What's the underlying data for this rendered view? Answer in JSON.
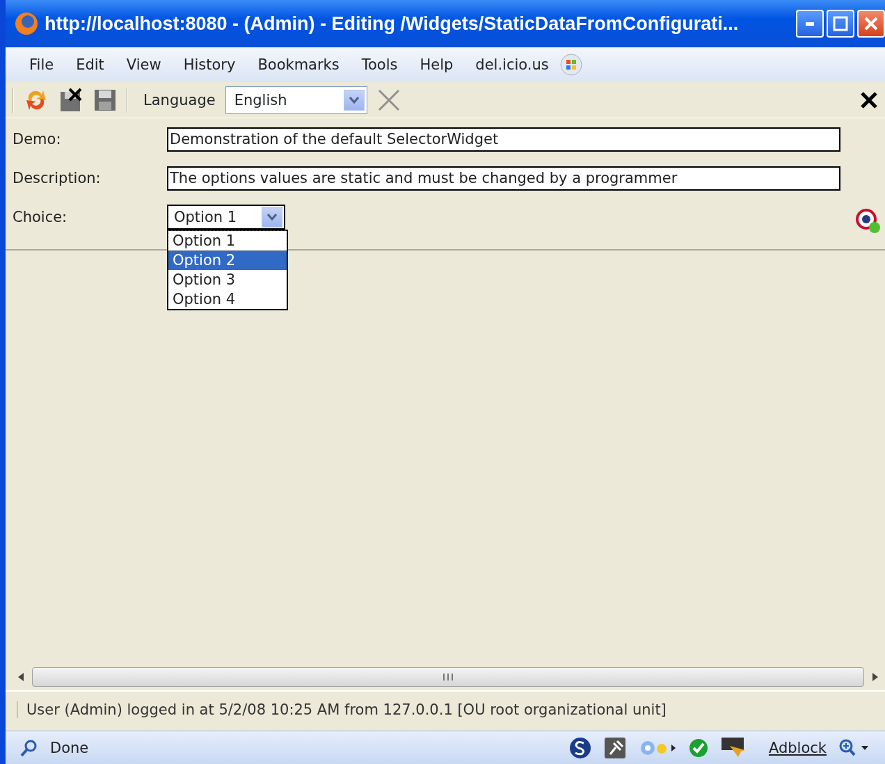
{
  "window": {
    "title": "http://localhost:8080 - (Admin) - Editing /Widgets/StaticDataFromConfigurati..."
  },
  "menu": [
    "File",
    "Edit",
    "View",
    "History",
    "Bookmarks",
    "Tools",
    "Help",
    "del.icio.us"
  ],
  "toolbar": {
    "language_label": "Language",
    "language_value": "English"
  },
  "fields": [
    {
      "kind": "text",
      "label": "Demo:",
      "value": "Demonstration of the default SelectorWidget"
    },
    {
      "kind": "text",
      "label": "Description:",
      "value": "The options values are static and must be changed by a programmer"
    },
    {
      "kind": "select",
      "label": "Choice:",
      "value": "Option 1",
      "expanded": true,
      "options": [
        {
          "label": "Option 1",
          "selected": true,
          "highlighted": false
        },
        {
          "label": "Option 2",
          "selected": false,
          "highlighted": true
        },
        {
          "label": "Option 3",
          "selected": false,
          "highlighted": false
        },
        {
          "label": "Option 4",
          "selected": false,
          "highlighted": false
        }
      ]
    }
  ],
  "app_status": "User (Admin) logged in at 5/2/08 10:25 AM from 127.0.0.1 [OU root organizational unit]",
  "status_bar": {
    "text": "Done",
    "addon": "Adblock"
  }
}
